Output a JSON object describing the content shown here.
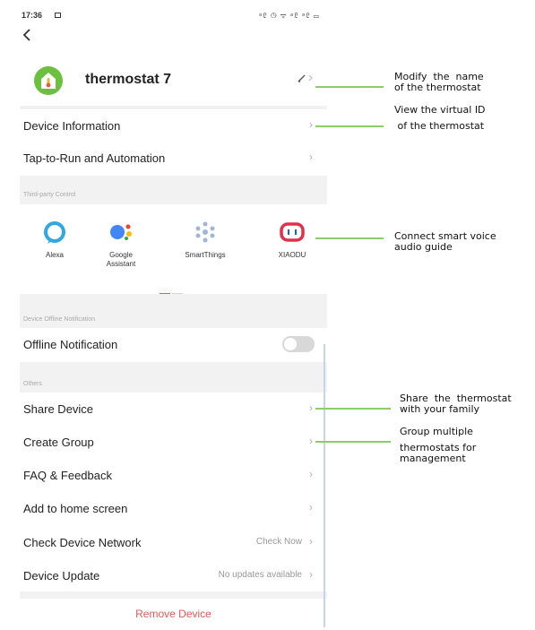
{
  "status_bar": {
    "time": "17:36",
    "icons": "ᵊ𝔏 ◷ ᯤ ᵊ𝔏 ᵊ𝔏 ▭"
  },
  "header": {
    "device_name": "thermostat 7",
    "edit_icon": "pencil-icon"
  },
  "menu_top": [
    {
      "label": "Device Information"
    },
    {
      "label": "Tap-to-Run and Automation"
    }
  ],
  "third_party": {
    "section_label": "Third-party Control",
    "items": [
      {
        "label": "Alexa",
        "icon": "alexa-icon",
        "color": "#31a8e3"
      },
      {
        "label": "Google Assistant",
        "icon": "google-assistant-icon",
        "color": "#4285f4"
      },
      {
        "label": "SmartThings",
        "icon": "smartthings-icon",
        "color": "#9fb6d6"
      },
      {
        "label": "XIAODU",
        "icon": "xiaodu-icon",
        "color": "#e0304a"
      }
    ]
  },
  "offline": {
    "section_label": "Device Offline Notification",
    "label": "Offline Notification",
    "enabled": false
  },
  "others": {
    "section_label": "Others",
    "items": [
      {
        "label": "Share Device",
        "value": ""
      },
      {
        "label": "Create Group",
        "value": ""
      },
      {
        "label": "FAQ & Feedback",
        "value": ""
      },
      {
        "label": "Add to home screen",
        "value": ""
      },
      {
        "label": "Check Device Network",
        "value": "Check Now"
      },
      {
        "label": "Device Update",
        "value": "No updates available"
      }
    ]
  },
  "remove_button": "Remove Device",
  "callouts": {
    "rename": [
      "Modify  the  name",
      "of the thermostat"
    ],
    "device_info": [
      "View the virtual ID",
      " of the thermostat"
    ],
    "voice": [
      "Connect smart voice",
      "audio guide"
    ],
    "share": [
      "Share  the  thermostat",
      "with your family"
    ],
    "group": [
      "Group multiple",
      "thermostats for",
      "management"
    ]
  },
  "colors": {
    "accent_green": "#6cbf3f",
    "remove_red": "#e05a5a",
    "callout_line": "#8ecb6a"
  }
}
